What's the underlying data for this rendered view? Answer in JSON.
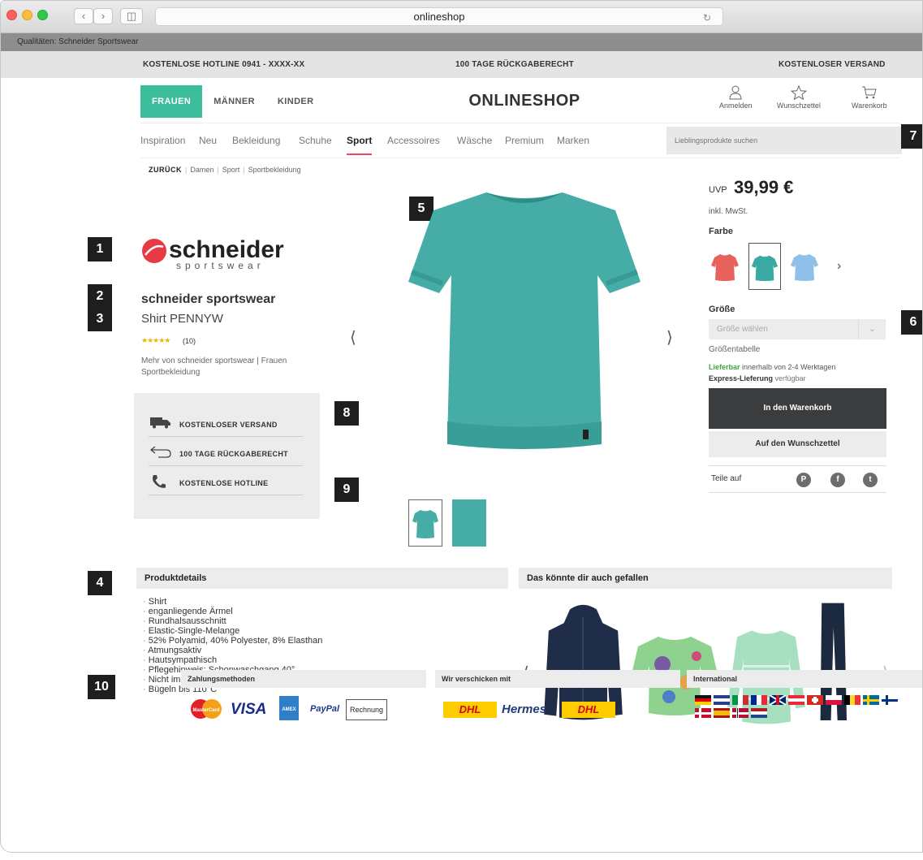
{
  "browser": {
    "url": "onlineshop",
    "bookmark": "Qualitäten: Schneider Sportswear"
  },
  "topbar": {
    "hotline": "KOSTENLOSE HOTLINE 0941 - XXXX-XX",
    "returns": "100 TAGE RÜCKGABERECHT",
    "shipping": "KOSTENLOSER VERSAND"
  },
  "header": {
    "tabs": [
      "FRAUEN",
      "MÄNNER",
      "KINDER"
    ],
    "logo": "ONLINESHOP",
    "account": {
      "login": "Anmelden",
      "wishlist": "Wunschzettel",
      "cart": "Warenkorb"
    }
  },
  "nav": {
    "categories": [
      "Inspiration",
      "Neu",
      "Bekleidung",
      "Schuhe",
      "Sport",
      "Accessoires",
      "Wäsche",
      "Premium",
      "Marken"
    ],
    "active": "Sport",
    "search_placeholder": "Lieblingsprodukte suchen"
  },
  "breadcrumb": {
    "back": "ZURÜCK",
    "items": [
      "Damen",
      "Sport",
      "Sportbekleidung"
    ]
  },
  "markers": [
    "1",
    "2",
    "3",
    "4",
    "5",
    "6",
    "7",
    "8",
    "9",
    "10"
  ],
  "product": {
    "brand_logo_top": "schneider",
    "brand_logo_bottom": "sportswear",
    "brand": "schneider sportswear",
    "name": "Shirt PENNYW",
    "stars": "★★★★★",
    "rating": "(10)",
    "more_line1": "Mehr von schneider sportswear | Frauen",
    "more_line2": "Sportbekleidung",
    "uvp_label": "UVP",
    "price": "39,99 €",
    "tax": "inkl. MwSt.",
    "color_label": "Farbe",
    "size_label": "Größe",
    "size_placeholder": "Größe wählen",
    "size_table": "Größentabelle",
    "availability_bold": "Lieferbar",
    "availability_rest": " innerhalb von 2-4 Werktagen",
    "express_bold": "Express-Lieferung",
    "express_rest": " verfügbar",
    "add_to_cart": "In den Warenkorb",
    "add_to_wishlist": "Auf den Wunschzettel",
    "share_label": "Teile auf"
  },
  "colors": {
    "accent": "#3cbd9c",
    "swatch_coral": "#e9615b",
    "swatch_teal": "#3aa9a4",
    "swatch_blue": "#8fc0ea",
    "cart_button": "#3a3c3d"
  },
  "services": [
    "KOSTENLOSER VERSAND",
    "100 TAGE RÜCKGABERECHT",
    "KOSTENLOSE HOTLINE"
  ],
  "details": {
    "title": "Produktdetails",
    "items": [
      "Shirt",
      "enganliegende Ärmel",
      "Rundhalsausschnitt",
      "Elastic-Single-Melange",
      "52% Polyamid, 40% Polyester, 8% Elasthan",
      "Atmungsaktiv",
      "Hautsympathisch",
      "Pflegehinweis: Schonwaschgang 40°",
      "Nicht im Wäschetrockner trocknen",
      "Bügeln bis 110°C"
    ]
  },
  "recommendations": {
    "title": "Das könnte dir auch gefallen"
  },
  "footer": {
    "payment_title": "Zahlungsmethoden",
    "payment": [
      "MasterCard",
      "VISA",
      "AMEX",
      "PayPal",
      "Rechnung"
    ],
    "shipping_title": "Wir verschicken mit",
    "carriers": [
      "DHL",
      "Hermes",
      "DHL"
    ],
    "international_title": "International"
  }
}
